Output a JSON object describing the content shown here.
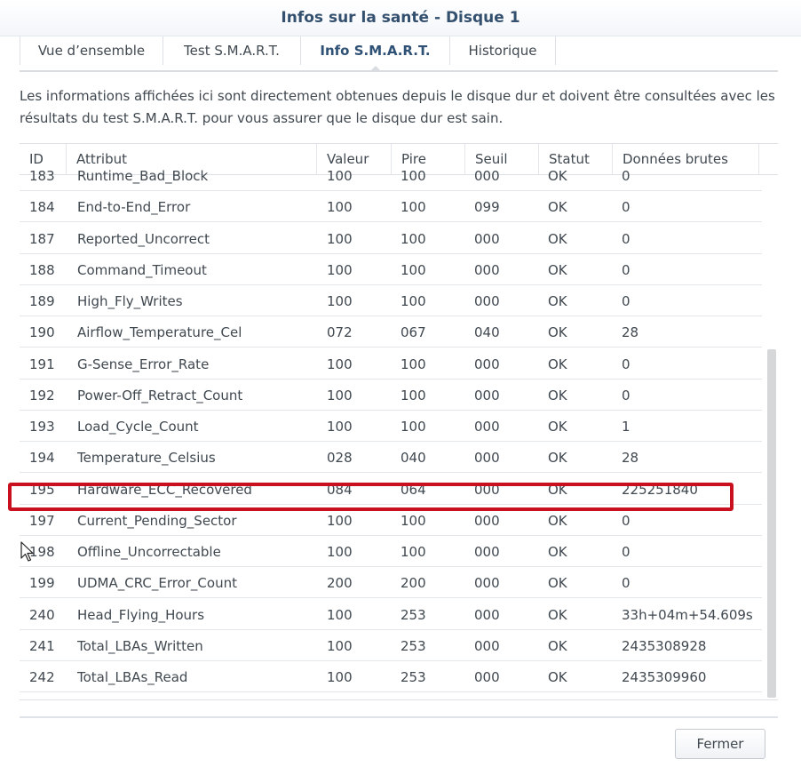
{
  "window": {
    "title": "Infos sur la santé - Disque 1"
  },
  "tabs": [
    {
      "label": "Vue d’ensemble",
      "active": false
    },
    {
      "label": "Test S.M.A.R.T.",
      "active": false
    },
    {
      "label": "Info S.M.A.R.T.",
      "active": true
    },
    {
      "label": "Historique",
      "active": false
    }
  ],
  "description": "Les informations affichées ici sont directement obtenues depuis le disque dur et doivent être consultées avec les résultats du test S.M.A.R.T. pour vous assurer que le disque dur est sain.",
  "table": {
    "headers": [
      "ID",
      "Attribut",
      "Valeur",
      "Pire",
      "Seuil",
      "Statut",
      "Données brutes"
    ],
    "rows": [
      [
        "183",
        "Runtime_Bad_Block",
        "100",
        "100",
        "000",
        "OK",
        "0"
      ],
      [
        "184",
        "End-to-End_Error",
        "100",
        "100",
        "099",
        "OK",
        "0"
      ],
      [
        "187",
        "Reported_Uncorrect",
        "100",
        "100",
        "000",
        "OK",
        "0"
      ],
      [
        "188",
        "Command_Timeout",
        "100",
        "100",
        "000",
        "OK",
        "0"
      ],
      [
        "189",
        "High_Fly_Writes",
        "100",
        "100",
        "000",
        "OK",
        "0"
      ],
      [
        "190",
        "Airflow_Temperature_Cel",
        "072",
        "067",
        "040",
        "OK",
        "28"
      ],
      [
        "191",
        "G-Sense_Error_Rate",
        "100",
        "100",
        "000",
        "OK",
        "0"
      ],
      [
        "192",
        "Power-Off_Retract_Count",
        "100",
        "100",
        "000",
        "OK",
        "0"
      ],
      [
        "193",
        "Load_Cycle_Count",
        "100",
        "100",
        "000",
        "OK",
        "1"
      ],
      [
        "194",
        "Temperature_Celsius",
        "028",
        "040",
        "000",
        "OK",
        "28"
      ],
      [
        "195",
        "Hardware_ECC_Recovered",
        "084",
        "064",
        "000",
        "OK",
        "225251840"
      ],
      [
        "197",
        "Current_Pending_Sector",
        "100",
        "100",
        "000",
        "OK",
        "0"
      ],
      [
        "198",
        "Offline_Uncorrectable",
        "100",
        "100",
        "000",
        "OK",
        "0"
      ],
      [
        "199",
        "UDMA_CRC_Error_Count",
        "200",
        "200",
        "000",
        "OK",
        "0"
      ],
      [
        "240",
        "Head_Flying_Hours",
        "100",
        "253",
        "000",
        "OK",
        "33h+04m+54.609s"
      ],
      [
        "241",
        "Total_LBAs_Written",
        "100",
        "253",
        "000",
        "OK",
        "2435308928"
      ],
      [
        "242",
        "Total_LBAs_Read",
        "100",
        "253",
        "000",
        "OK",
        "2435309960"
      ]
    ],
    "highlighted_row_id": "195"
  },
  "footer": {
    "close_label": "Fermer"
  },
  "colors": {
    "title": "#34506f",
    "highlight": "#c8101e",
    "active_tab": "#2f5175"
  }
}
